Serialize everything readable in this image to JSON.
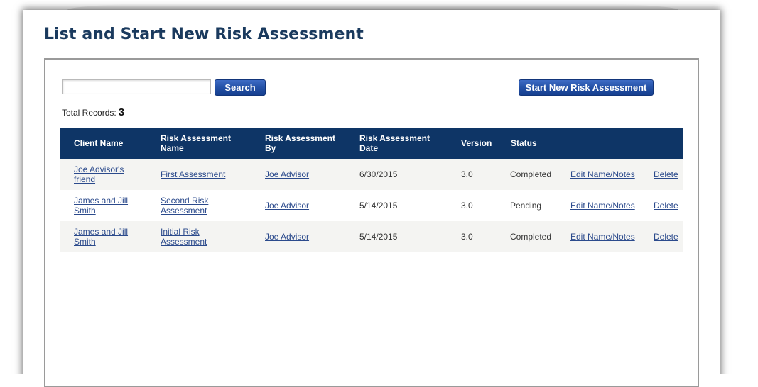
{
  "page": {
    "title": "List and Start New Risk Assessment"
  },
  "search": {
    "value": "",
    "button_label": "Search"
  },
  "start_button_label": "Start New Risk Assessment",
  "total_records": {
    "label": "Total Records:",
    "count": "3"
  },
  "table": {
    "headers": {
      "client_name": "Client Name",
      "ra_name_line1": "Risk Assessment",
      "ra_name_line2": "Name",
      "ra_by_line1": "Risk Assessment",
      "ra_by_line2": "By",
      "ra_date_line1": "Risk Assessment",
      "ra_date_line2": "Date",
      "version": "Version",
      "status": "Status"
    },
    "rows": [
      {
        "client_line1": "Joe Advisor's",
        "client_line2": "friend",
        "name_line1": "First Assessment",
        "name_line2": "",
        "by": "Joe Advisor",
        "date": "6/30/2015",
        "version": "3.0",
        "status": "Completed",
        "edit_label": "Edit Name/Notes",
        "delete_label": "Delete"
      },
      {
        "client_line1": "James and Jill",
        "client_line2": "Smith",
        "name_line1": "Second Risk",
        "name_line2": "Assessment",
        "by": "Joe Advisor",
        "date": "5/14/2015",
        "version": "3.0",
        "status": "Pending",
        "edit_label": "Edit Name/Notes",
        "delete_label": "Delete"
      },
      {
        "client_line1": "James and Jill",
        "client_line2": "Smith",
        "name_line1": "Initial Risk",
        "name_line2": "Assessment",
        "by": "Joe Advisor",
        "date": "5/14/2015",
        "version": "3.0",
        "status": "Completed",
        "edit_label": "Edit Name/Notes",
        "delete_label": "Delete"
      }
    ]
  }
}
